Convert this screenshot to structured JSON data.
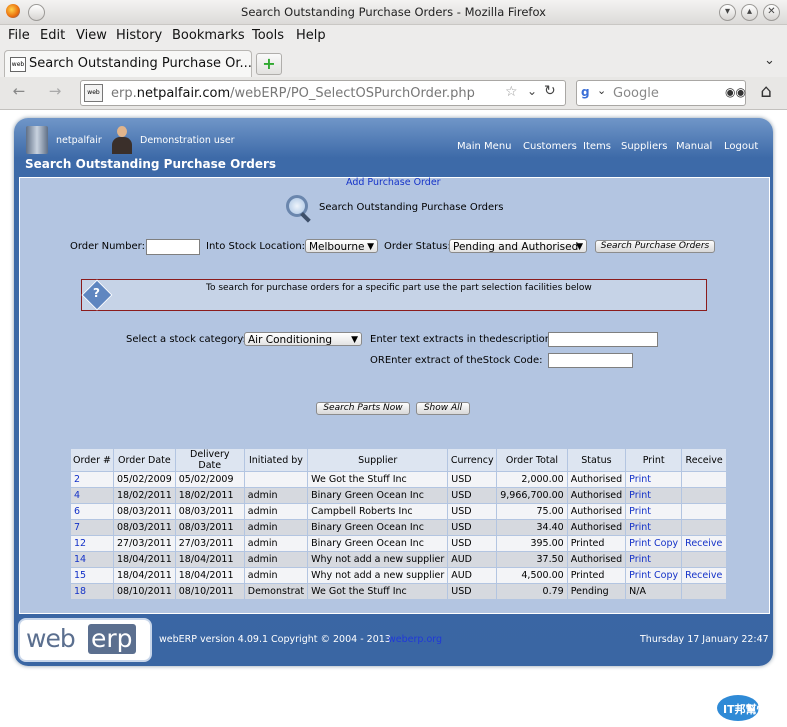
{
  "window": {
    "title": "Search Outstanding Purchase Orders - Mozilla Firefox"
  },
  "menubar": [
    "File",
    "Edit",
    "View",
    "History",
    "Bookmarks",
    "Tools",
    "Help"
  ],
  "tab": {
    "label": "Search Outstanding Purchase Or..."
  },
  "address": {
    "prefix": "erp.",
    "domain": "netpalfair.com",
    "path": "/webERP/PO_SelectOSPurchOrder.php"
  },
  "search_engine": {
    "placeholder": "Google"
  },
  "header": {
    "company": "netpalfair",
    "user": "Demonstration user",
    "page_title": "Search Outstanding Purchase Orders",
    "nav": [
      "Main Menu",
      "Customers",
      "Items",
      "Suppliers",
      "Manual",
      "Logout"
    ]
  },
  "main": {
    "add_link": "Add Purchase Order",
    "section_title": "Search Outstanding Purchase Orders",
    "order_number_label": "Order Number:",
    "location_label": "Into Stock Location:",
    "location_value": "Melbourne",
    "status_label": "Order Status:",
    "status_value": "Pending and Authorised",
    "search_orders_button": "Search Purchase Orders",
    "info_text": "To search for purchase orders for a specific part use the part selection facilities below",
    "category_label": "Select a stock category:",
    "category_value": "Air Conditioning",
    "desc_label": "Enter text extracts in thedescription:",
    "code_label": "OREnter extract of theStock Code:",
    "search_parts_button": "Search Parts Now",
    "show_all_button": "Show All"
  },
  "table": {
    "headers": [
      "Order #",
      "Order Date",
      "Delivery Date",
      "Initiated by",
      "Supplier",
      "Currency",
      "Order Total",
      "Status",
      "Print",
      "Receive"
    ],
    "rows": [
      {
        "order": "2",
        "order_date": "05/02/2009",
        "delivery": "05/02/2009",
        "by": "",
        "supplier": "We Got the Stuff Inc",
        "currency": "USD",
        "total": "2,000.00",
        "status": "Authorised",
        "print": "Print",
        "copy": "",
        "receive": ""
      },
      {
        "order": "4",
        "order_date": "18/02/2011",
        "delivery": "18/02/2011",
        "by": "admin",
        "supplier": "Binary Green Ocean Inc",
        "currency": "USD",
        "total": "9,966,700.00",
        "status": "Authorised",
        "print": "Print",
        "copy": "",
        "receive": ""
      },
      {
        "order": "6",
        "order_date": "08/03/2011",
        "delivery": "08/03/2011",
        "by": "admin",
        "supplier": "Campbell Roberts Inc",
        "currency": "USD",
        "total": "75.00",
        "status": "Authorised",
        "print": "Print",
        "copy": "",
        "receive": ""
      },
      {
        "order": "7",
        "order_date": "08/03/2011",
        "delivery": "08/03/2011",
        "by": "admin",
        "supplier": "Binary Green Ocean Inc",
        "currency": "USD",
        "total": "34.40",
        "status": "Authorised",
        "print": "Print",
        "copy": "",
        "receive": ""
      },
      {
        "order": "12",
        "order_date": "27/03/2011",
        "delivery": "27/03/2011",
        "by": "admin",
        "supplier": "Binary Green Ocean Inc",
        "currency": "USD",
        "total": "395.00",
        "status": "Printed",
        "print": "Print",
        "copy": "Copy",
        "receive": "Receive"
      },
      {
        "order": "14",
        "order_date": "18/04/2011",
        "delivery": "18/04/2011",
        "by": "admin",
        "supplier": "Why not add a new supplier",
        "currency": "AUD",
        "total": "37.50",
        "status": "Authorised",
        "print": "Print",
        "copy": "",
        "receive": ""
      },
      {
        "order": "15",
        "order_date": "18/04/2011",
        "delivery": "18/04/2011",
        "by": "admin",
        "supplier": "Why not add a new supplier",
        "currency": "AUD",
        "total": "4,500.00",
        "status": "Printed",
        "print": "Print",
        "copy": "Copy",
        "receive": "Receive"
      },
      {
        "order": "18",
        "order_date": "08/10/2011",
        "delivery": "08/10/2011",
        "by": "Demonstrat",
        "supplier": "We Got the Stuff Inc",
        "currency": "USD",
        "total": "0.79",
        "status": "Pending",
        "print": "N/A",
        "copy": "",
        "receive": ""
      }
    ]
  },
  "footer": {
    "logo_left": "web",
    "logo_right": "erp",
    "version": "webERP version 4.09.1 Copyright © 2004 - 2013",
    "site": "weberp.org",
    "datetime": "Thursday 17 January 22:47"
  },
  "watermark": "IT邦幫忙"
}
